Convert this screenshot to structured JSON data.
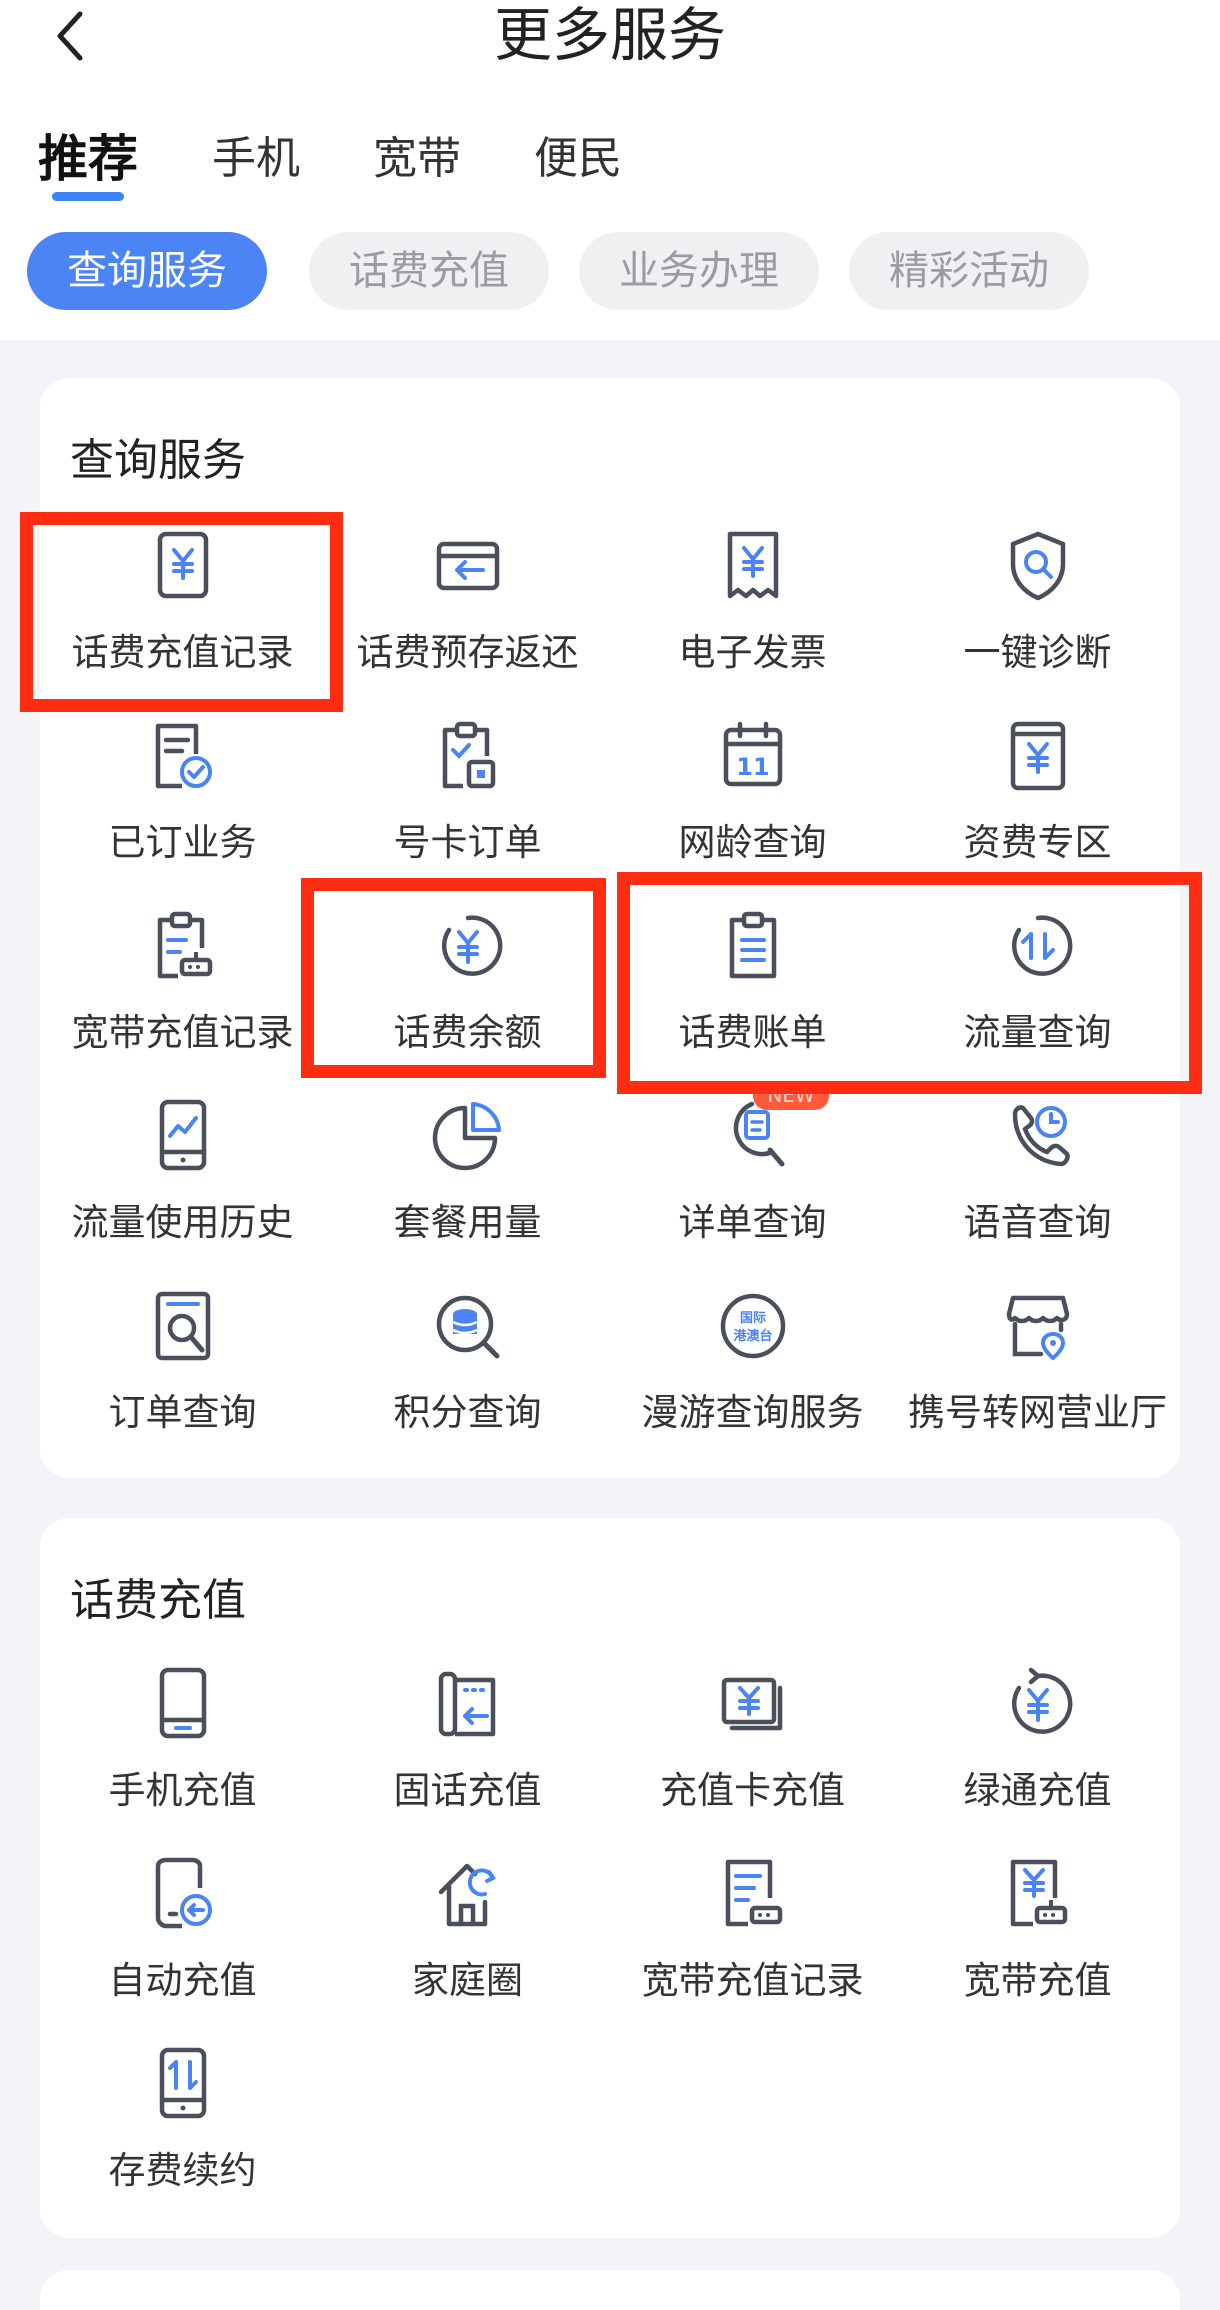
{
  "header": {
    "title": "更多服务"
  },
  "tabs": [
    {
      "label": "推荐"
    },
    {
      "label": "手机"
    },
    {
      "label": "宽带"
    },
    {
      "label": "便民"
    }
  ],
  "chips": [
    {
      "label": "查询服务"
    },
    {
      "label": "话费充值"
    },
    {
      "label": "业务办理"
    },
    {
      "label": "精彩活动"
    }
  ],
  "query_section": {
    "title": "查询服务",
    "items": [
      {
        "label": "话费充值记录",
        "icon": "yen-phone-icon"
      },
      {
        "label": "话费预存返还",
        "icon": "card-return-icon"
      },
      {
        "label": "电子发票",
        "icon": "invoice-icon"
      },
      {
        "label": "一键诊断",
        "icon": "shield-search-icon"
      },
      {
        "label": "已订业务",
        "icon": "doc-check-icon"
      },
      {
        "label": "号卡订单",
        "icon": "clipboard-sim-icon"
      },
      {
        "label": "网龄查询",
        "icon": "calendar-icon",
        "icon_text": "11"
      },
      {
        "label": "资费专区",
        "icon": "yen-tablet-icon"
      },
      {
        "label": "宽带充值记录",
        "icon": "clipboard-router-icon"
      },
      {
        "label": "话费余额",
        "icon": "yen-circle-icon"
      },
      {
        "label": "话费账单",
        "icon": "bill-icon"
      },
      {
        "label": "流量查询",
        "icon": "arrows-circle-icon"
      },
      {
        "label": "流量使用历史",
        "icon": "phone-chart-icon"
      },
      {
        "label": "套餐用量",
        "icon": "pie-chart-icon"
      },
      {
        "label": "详单查询",
        "icon": "doc-search-icon",
        "badge": "NEW"
      },
      {
        "label": "语音查询",
        "icon": "phone-clock-icon"
      },
      {
        "label": "订单查询",
        "icon": "order-search-icon"
      },
      {
        "label": "积分查询",
        "icon": "coins-search-icon"
      },
      {
        "label": "漫游查询服务",
        "icon": "roaming-badge-icon",
        "icon_text": "国际港澳台"
      },
      {
        "label": "携号转网营业厅",
        "icon": "store-location-icon"
      }
    ]
  },
  "recharge_section": {
    "title": "话费充值",
    "items": [
      {
        "label": "手机充值",
        "icon": "mobile-icon"
      },
      {
        "label": "固话充值",
        "icon": "landline-icon"
      },
      {
        "label": "充值卡充值",
        "icon": "yen-card-icon"
      },
      {
        "label": "绿通充值",
        "icon": "yen-refresh-icon"
      },
      {
        "label": "自动充值",
        "icon": "phone-back-icon"
      },
      {
        "label": "家庭圈",
        "icon": "home-refresh-icon"
      },
      {
        "label": "宽带充值记录",
        "icon": "doc-router-icon"
      },
      {
        "label": "宽带充值",
        "icon": "yen-router-icon"
      },
      {
        "label": "存费续约",
        "icon": "phone-arrows-icon"
      }
    ]
  },
  "colors": {
    "accent": "#4b84f5",
    "icon_blue": "#4a84f3",
    "highlight": "#ff2d12"
  }
}
